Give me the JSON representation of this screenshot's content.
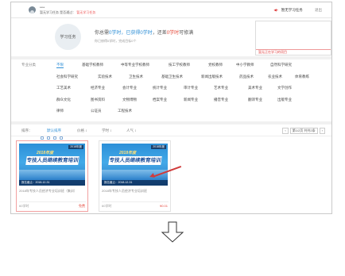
{
  "header": {
    "username": "****",
    "info_label": "暂无学习任务",
    "info_mid": "是否通过：",
    "info_value": "暂无学习任务",
    "task_link": "暂无学习任务",
    "logout": "退出"
  },
  "stats": {
    "circle_label": "学习任务",
    "line_part1": "你总需",
    "line_need": "0学时",
    "line_part2": "，已获得",
    "line_got": "0学时",
    "line_part3": "，还差",
    "line_left": "0学时",
    "line_part4": "可修满",
    "sub": "你已修得0学时，完成目标0个",
    "empty_task": "暂无正在学习的项目"
  },
  "categories": {
    "label": "专业分类",
    "rows": [
      [
        "不限",
        "基础学校教师",
        "中等专业学校教师",
        "技工学校教师",
        "党校教师",
        "中小学教师",
        "自然科学研究"
      ],
      [
        "社会科学研究",
        "实验技术",
        "卫生技术",
        "基础卫生技术",
        "新闻出版技术",
        "药品技术",
        "农业技术",
        "体育教练"
      ],
      [
        "工艺美术",
        "经济专业",
        "会计专业",
        "统计专业",
        "审计专业",
        "艺术专业",
        "美术专业",
        "文学创作"
      ],
      [
        "群众文化",
        "图书资料",
        "文物博物",
        "档案专业",
        "新闻专业",
        "播音专业",
        "翻译专业",
        "出版专业"
      ],
      [
        "律师",
        "公证员",
        "工程技术"
      ]
    ]
  },
  "sortbar": {
    "label": "排序：",
    "items": [
      "默认排序",
      "价格 ↕",
      "学时 ↕",
      "人气 ↕"
    ],
    "pager_prev": "‹",
    "pager_info": "第1/2页 共共2条",
    "pager_next": "›"
  },
  "cards": [
    {
      "year": "2018年度",
      "banner_top": "2018年度",
      "banner_main": "专技人员继续教育培训",
      "date": "报名截止：2018-12-31",
      "title": "2018年专技人员经济专业培训班（集训）",
      "hours": "60学时",
      "price": "免费"
    },
    {
      "year": "2018年度",
      "banner_top": "2018年度",
      "banner_main": "专技人员继续教育培训",
      "date": "报名截止：2018-12-31",
      "title": "2018年专技人员经济专业培训班",
      "hours": "60学时",
      "price": "¥0.01"
    }
  ],
  "colors": {
    "accent": "#2f8fd6",
    "alert": "#e54b3c",
    "arrow": "#d03b3b"
  }
}
